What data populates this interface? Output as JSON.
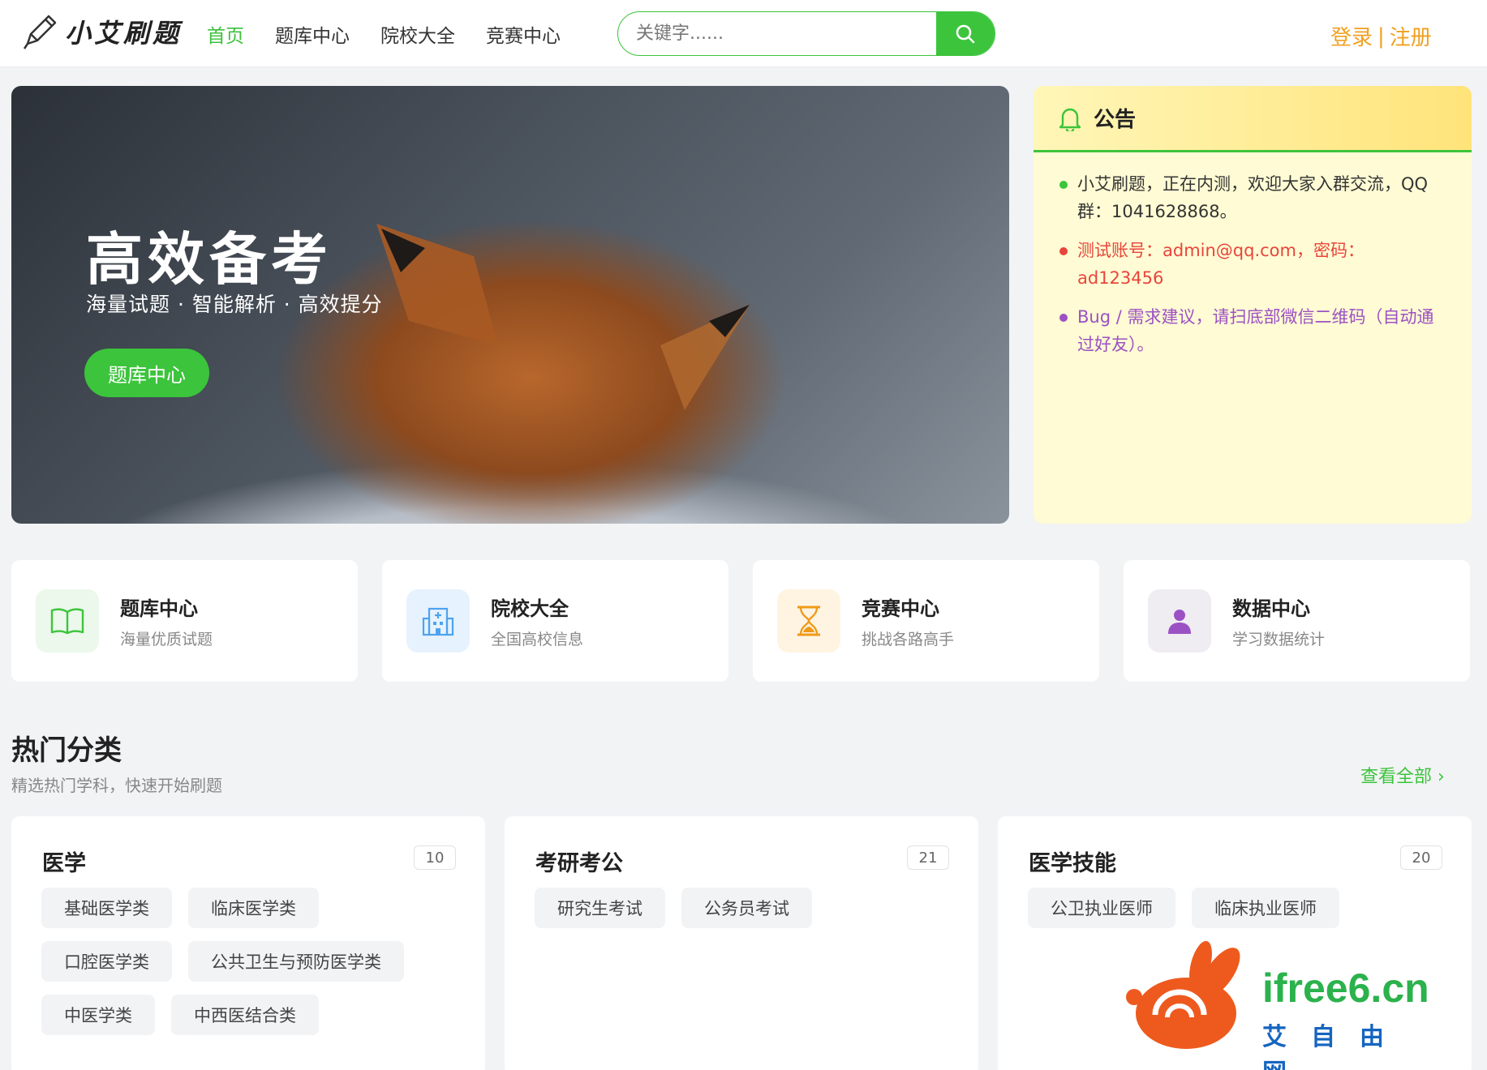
{
  "header": {
    "logo_text": "小艾刷题",
    "nav": [
      "首页",
      "题库中心",
      "院校大全",
      "竞赛中心"
    ],
    "search_placeholder": "关键字......",
    "login": "登录",
    "separator": "|",
    "register": "注册"
  },
  "hero": {
    "title": "高效备考",
    "subtitle": "海量试题 · 智能解析 · 高效提分",
    "button": "题库中心"
  },
  "notice": {
    "title": "公告",
    "items": [
      {
        "text": "小艾刷题，正在内测，欢迎大家入群交流，QQ群：1041628868。",
        "color": "#333333",
        "dot": "#3cc43c"
      },
      {
        "text": "测试账号：admin@qq.com，密码：ad123456",
        "color": "#e8453c",
        "dot": "#e8453c"
      },
      {
        "text": "Bug / 需求建议，请扫底部微信二维码（自动通过好友）。",
        "color": "#9b51c4",
        "dot": "#9b51c4"
      }
    ]
  },
  "features": [
    {
      "title": "题库中心",
      "sub": "海量优质试题",
      "icon": "book-icon"
    },
    {
      "title": "院校大全",
      "sub": "全国高校信息",
      "icon": "building-icon"
    },
    {
      "title": "竞赛中心",
      "sub": "挑战各路高手",
      "icon": "hourglass-icon"
    },
    {
      "title": "数据中心",
      "sub": "学习数据统计",
      "icon": "user-icon"
    }
  ],
  "hot": {
    "title": "热门分类",
    "subtitle": "精选热门学科，快速开始刷题",
    "view_all": "查看全部 ›"
  },
  "categories": [
    {
      "name": "医学",
      "count": "10",
      "tags": [
        "基础医学类",
        "临床医学类",
        "口腔医学类",
        "公共卫生与预防医学类",
        "中医学类",
        "中西医结合类"
      ]
    },
    {
      "name": "考研考公",
      "count": "21",
      "tags": [
        "研究生考试",
        "公务员考试"
      ]
    },
    {
      "name": "医学技能",
      "count": "20",
      "tags": [
        "公卫执业医师",
        "临床执业医师"
      ]
    }
  ],
  "watermark": {
    "domain": "ifree6.cn",
    "cn": "艾自由网"
  },
  "colors": {
    "accent": "#3cc43c",
    "auth": "#f0a020"
  }
}
